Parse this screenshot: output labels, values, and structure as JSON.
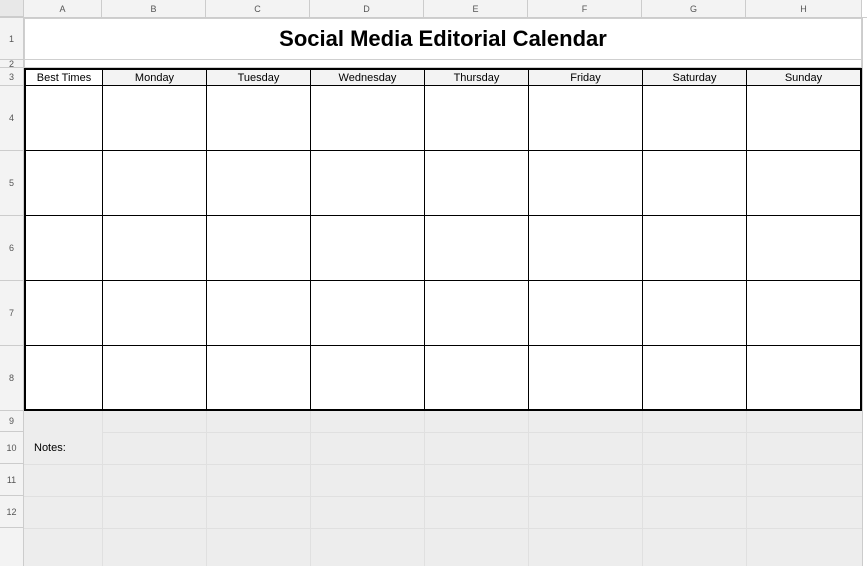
{
  "columns": [
    "A",
    "B",
    "C",
    "D",
    "E",
    "F",
    "G",
    "H"
  ],
  "rows": [
    "1",
    "2",
    "3",
    "4",
    "5",
    "6",
    "7",
    "8",
    "9",
    "10",
    "11",
    "12"
  ],
  "title": "Social Media Editorial Calendar",
  "headers": [
    "Best Times",
    "Monday",
    "Tuesday",
    "Wednesday",
    "Thursday",
    "Friday",
    "Saturday",
    "Sunday"
  ],
  "notes_label": "Notes:"
}
